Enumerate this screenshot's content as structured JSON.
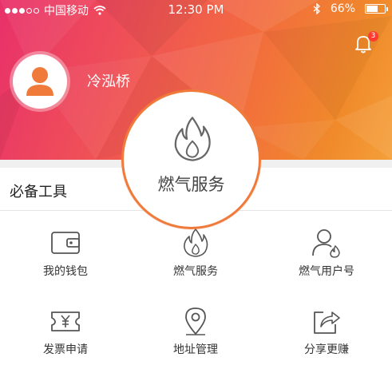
{
  "status_bar": {
    "carrier": "中国移动",
    "time": "12:30 PM",
    "battery": "66%"
  },
  "header": {
    "username": "冷泓桥",
    "notification_count": "3"
  },
  "featured": {
    "label": "燃气服务",
    "icon": "flame-icon"
  },
  "tools": {
    "title": "必备工具",
    "items": [
      {
        "label": "我的钱包",
        "icon": "wallet-icon"
      },
      {
        "label": "燃气服务",
        "icon": "flame-icon"
      },
      {
        "label": "燃气用户号",
        "icon": "user-flame-icon"
      },
      {
        "label": "发票申请",
        "icon": "invoice-icon"
      },
      {
        "label": "地址管理",
        "icon": "location-pin-icon"
      },
      {
        "label": "分享更赚",
        "icon": "share-icon"
      }
    ]
  },
  "colors": {
    "accent": "#f07a3a",
    "header_start": "#e8306a",
    "header_end": "#f4a03a"
  }
}
